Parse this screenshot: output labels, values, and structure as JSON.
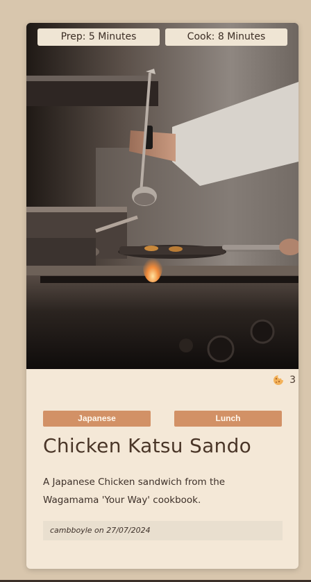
{
  "recipe": {
    "prep_time": "Prep: 5 Minutes",
    "cook_time": "Cook: 8 Minutes",
    "tags": [
      "Japanese",
      "Lunch"
    ],
    "title": "Chicken Katsu Sando",
    "description": "A Japanese Chicken sandwich from the Wagamama 'Your Way' cookbook.",
    "author_line": "cambboyle on 27/07/2024",
    "reaction_count": "3",
    "reaction_icon": "cookie-icon"
  },
  "colors": {
    "background": "#d8c6ad",
    "card": "#f4e8d7",
    "tag": "#d29166",
    "title": "#4a3628",
    "pill": "#efe5d4"
  },
  "hero_image": {
    "depicts": "chef-cooking-at-stove-photo"
  }
}
